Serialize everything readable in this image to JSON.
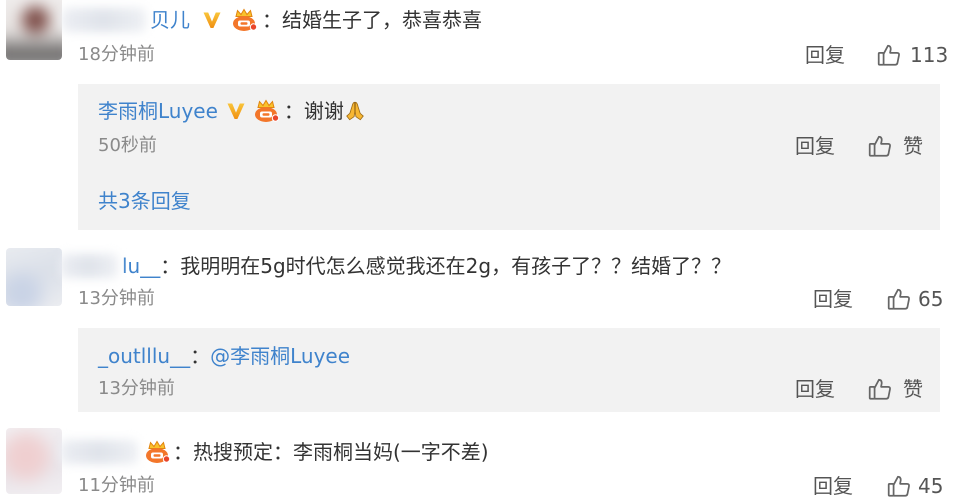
{
  "colors": {
    "link_blue": "#3f83cc",
    "body_text": "#333333",
    "muted_text": "#8a8a8a",
    "reply_box_bg": "#f2f2f2",
    "badge_orange": "#f5a21b"
  },
  "icons": {
    "verified": "verified-v-icon",
    "member": "crown-badge-icon",
    "like": "thumbs-up-icon",
    "emoji": "folded-hands-icon"
  },
  "comments": [
    {
      "author_visible": "贝儿",
      "badges": [
        "verified-v-icon",
        "crown-badge-icon"
      ],
      "text": "：结婚生子了，恭喜恭喜",
      "time": "18分钟前",
      "reply_label": "回复",
      "like_count": "113",
      "replies": [
        {
          "author": "李雨桐Luyee",
          "badges": [
            "verified-v-icon",
            "crown-badge-icon"
          ],
          "text": "：谢谢",
          "emoji": "folded-hands-icon",
          "time": "50秒前",
          "reply_label": "回复",
          "like_label": "赞"
        }
      ],
      "more_replies_label": "共3条回复"
    },
    {
      "author_visible": "lu__",
      "badges": [],
      "text": "：我明明在5g时代怎么感觉我还在2g，有孩子了？？结婚了？？",
      "time": "13分钟前",
      "reply_label": "回复",
      "like_count": "65",
      "replies": [
        {
          "author": "_outlllu__",
          "text": "：",
          "mention": "@李雨桐Luyee",
          "time": "13分钟前",
          "reply_label": "回复",
          "like_label": "赞"
        }
      ]
    },
    {
      "badges": [
        "crown-badge-icon"
      ],
      "text": "：热搜预定：李雨桐当妈(一字不差)",
      "time": "11分钟前",
      "reply_label": "回复",
      "like_count": "45",
      "replies": []
    }
  ]
}
